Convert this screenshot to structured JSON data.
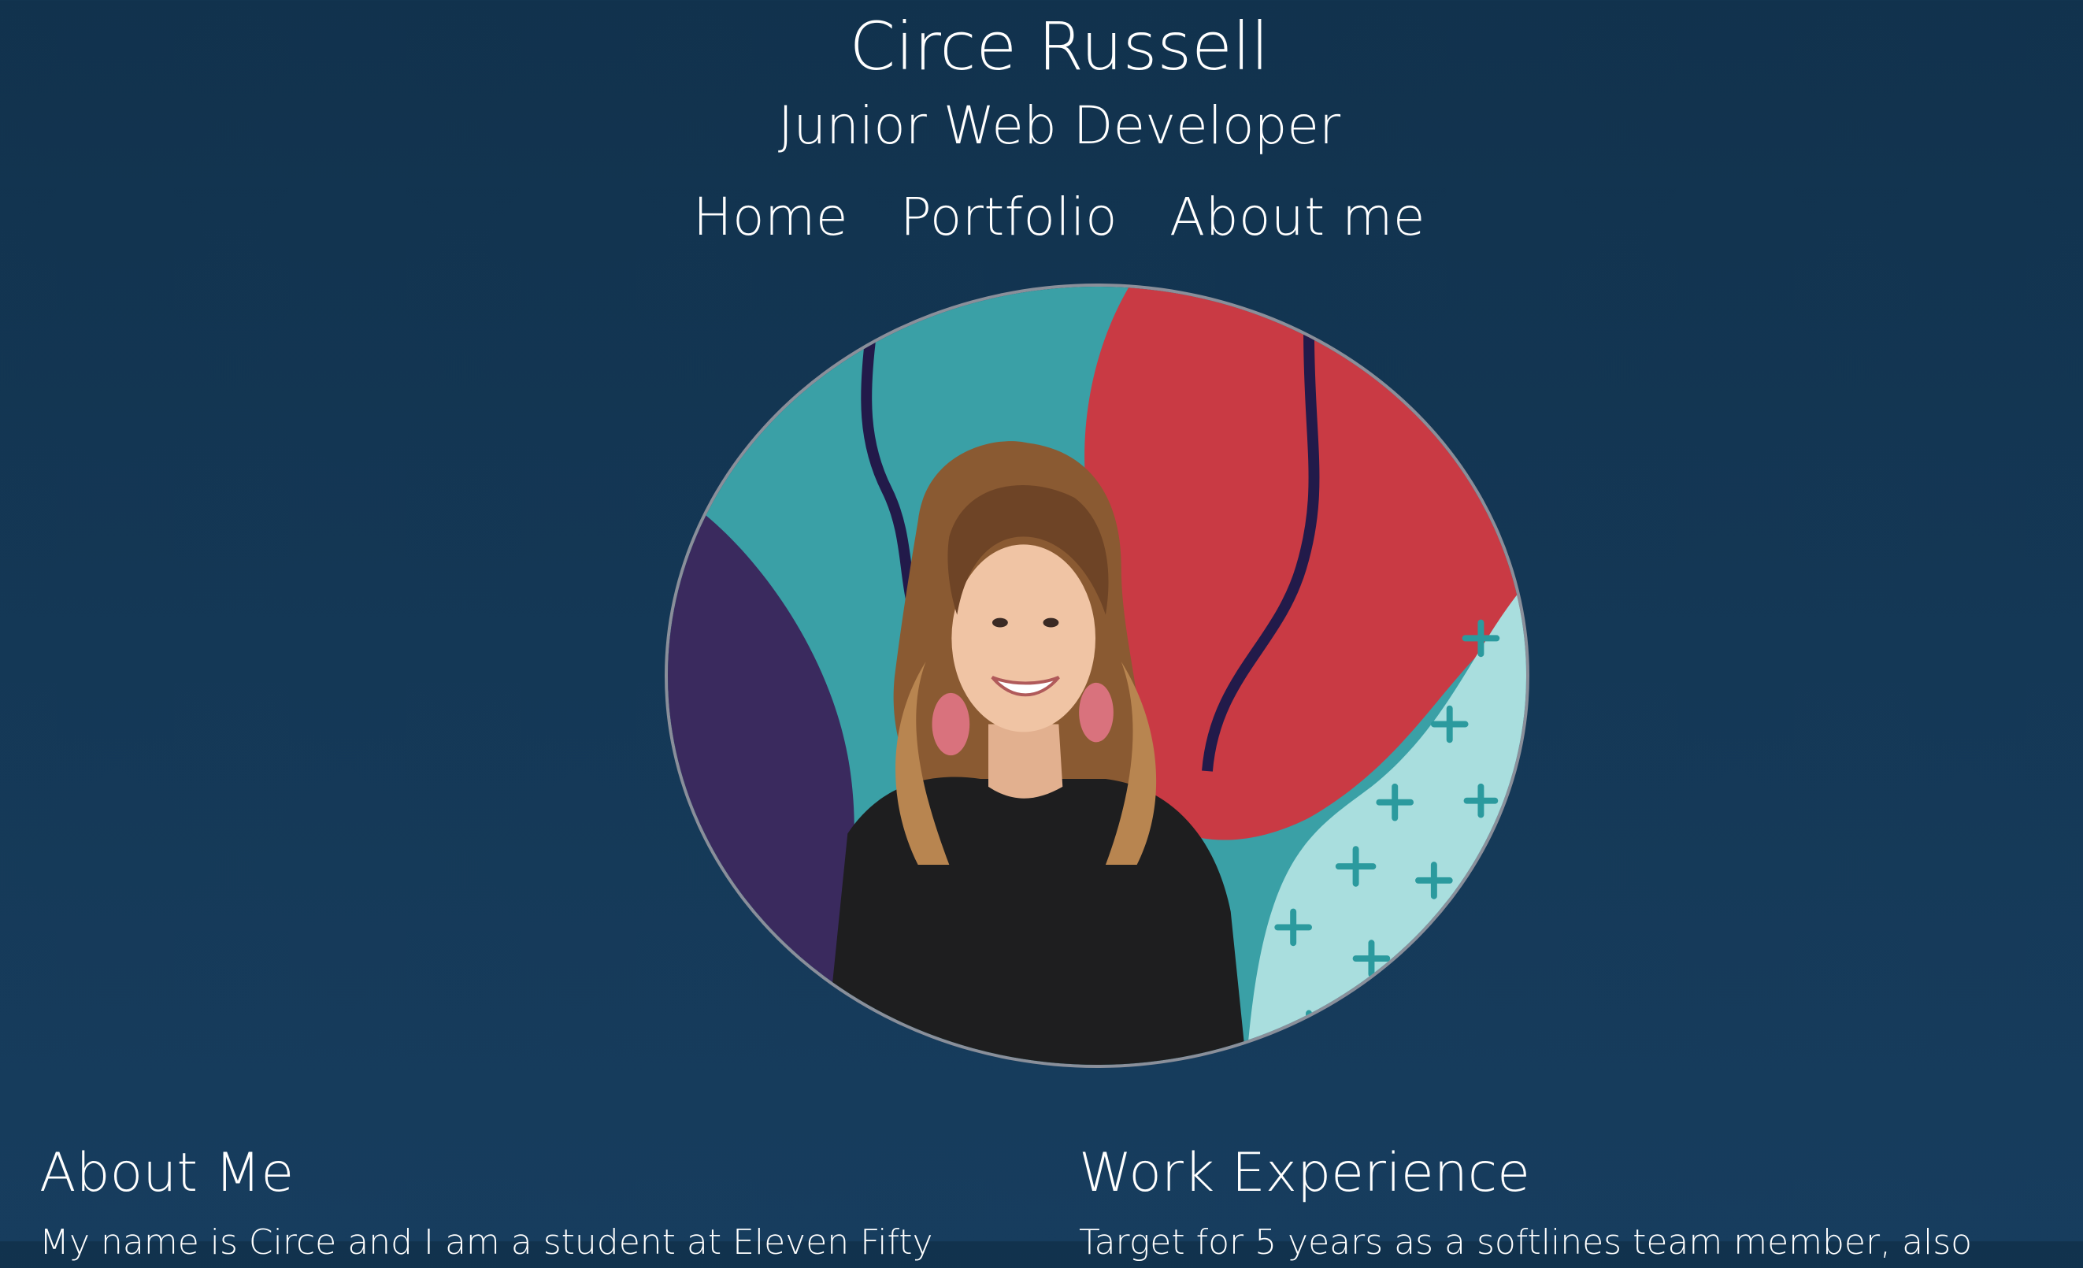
{
  "header": {
    "name": "Circe Russell",
    "role": "Junior Web Developer"
  },
  "nav": {
    "home": "Home",
    "portfolio": "Portfolio",
    "about": "About me"
  },
  "portrait": {
    "icon": "profile-photo"
  },
  "about": {
    "title": "About Me",
    "text": "My name is Circe and I am a student at Eleven Fifty"
  },
  "work": {
    "title": "Work Experience",
    "text": "Target for 5 years as a softlines team member, also"
  },
  "colors": {
    "background_top": "#11324d",
    "background_bottom": "#173d5e",
    "text": "#ffffff",
    "photo_border": "#8a8f9a"
  }
}
